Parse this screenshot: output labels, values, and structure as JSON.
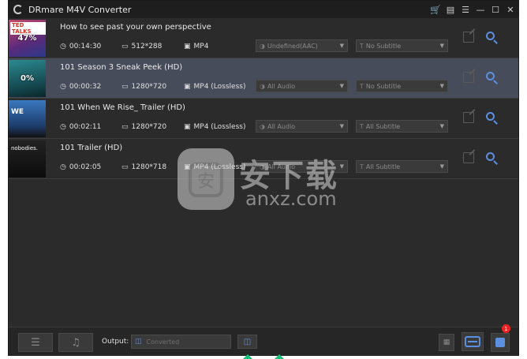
{
  "app": {
    "title": "DRmare M4V Converter"
  },
  "titlebar": {
    "icons": [
      "cart-icon",
      "register-icon",
      "menu-icon",
      "minimize-icon",
      "maximize-icon",
      "close-icon"
    ]
  },
  "rows": [
    {
      "title": "How to see past your own perspective",
      "progress": "47%",
      "thumb_logo": "TED TALKS",
      "duration": "00:14:30",
      "resolution": "512*288",
      "format": "MP4",
      "audio": "Undefined(AAC)",
      "subtitle": "No Subtitle",
      "thumb_color": "#8a3a5c"
    },
    {
      "title": "101 Season 3 Sneak Peek (HD)",
      "progress": "0%",
      "thumb_logo": "",
      "duration": "00:00:32",
      "resolution": "1280*720",
      "format": "MP4 (Lossless)",
      "audio": "All Audio",
      "subtitle": "No Subtitle",
      "thumb_color": "#1d6f78"
    },
    {
      "title": "101 When We Rise_ Trailer (HD)",
      "progress": "",
      "thumb_logo": "WE",
      "duration": "00:02:11",
      "resolution": "1280*720",
      "format": "MP4 (Lossless)",
      "audio": "All Audio",
      "subtitle": "All Subtitle",
      "thumb_color": "#2a5a9a"
    },
    {
      "title": "101 Trailer (HD)",
      "progress": "",
      "thumb_logo": "nobodies.",
      "duration": "00:02:05",
      "resolution": "1280*718",
      "format": "MP4 (Lossless)",
      "audio": "All Audio",
      "subtitle": "All Subtitle",
      "thumb_color": "#151515"
    }
  ],
  "bottom": {
    "output_label": "Output:",
    "output_path": "Converted",
    "badge_count": "1"
  },
  "watermark": {
    "cn": "安下载",
    "en": "anxz.com",
    "shield_char": "安"
  },
  "colors": {
    "accent": "#5c8fe0",
    "selected_row": "#474c5b",
    "cart": "#f0b400",
    "badge": "#e22222"
  }
}
